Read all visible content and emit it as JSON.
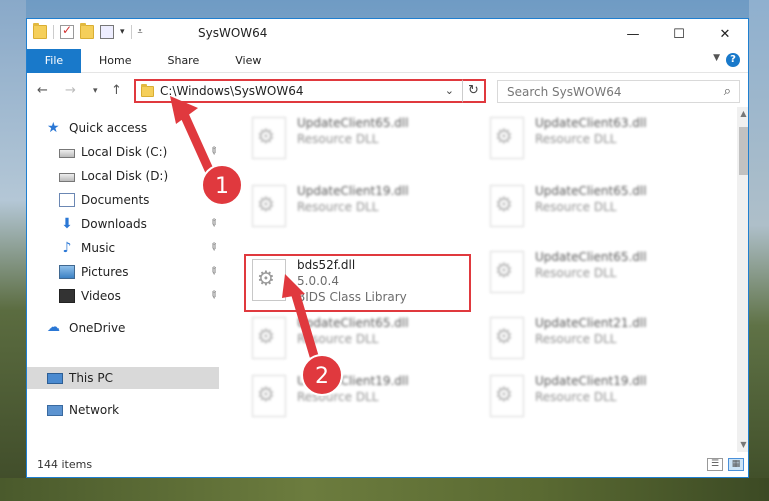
{
  "window": {
    "title": "SysWOW64",
    "controls": {
      "minimize": "—",
      "maximize": "☐",
      "close": "✕"
    }
  },
  "ribbon": {
    "tabs": [
      "File",
      "Home",
      "Share",
      "View"
    ],
    "help": "?"
  },
  "address_bar": {
    "path": "C:\\Windows\\SysWOW64",
    "refresh_icon": "refresh-icon"
  },
  "search": {
    "placeholder": "Search SysWOW64"
  },
  "sidebar": {
    "items": [
      {
        "label": "Quick access",
        "icon": "star-icon",
        "pinned": false
      },
      {
        "label": "Local Disk (C:)",
        "icon": "disk-icon",
        "pinned": true
      },
      {
        "label": "Local Disk (D:)",
        "icon": "disk-icon",
        "pinned": false
      },
      {
        "label": "Documents",
        "icon": "documents-icon",
        "pinned": true
      },
      {
        "label": "Downloads",
        "icon": "downloads-icon",
        "pinned": true
      },
      {
        "label": "Music",
        "icon": "music-icon",
        "pinned": true
      },
      {
        "label": "Pictures",
        "icon": "pictures-icon",
        "pinned": true
      },
      {
        "label": "Videos",
        "icon": "videos-icon",
        "pinned": true
      },
      {
        "label": "OneDrive",
        "icon": "cloud-icon",
        "pinned": false
      },
      {
        "label": "This PC",
        "icon": "computer-icon",
        "pinned": false,
        "selected": true
      },
      {
        "label": "Network",
        "icon": "network-icon",
        "pinned": false
      }
    ]
  },
  "files": {
    "left": [
      {
        "name": "UpdateClient65.dll",
        "line2": "Resource DLL"
      },
      {
        "name": "UpdateClient19.dll",
        "line2": "Resource DLL"
      },
      {
        "name": "bds52f.dll",
        "line2": "5.0.0.4",
        "line3": "BIDS Class Library",
        "highlighted": true
      },
      {
        "name": "UpdateClient65.dll",
        "line2": "Resource DLL"
      },
      {
        "name": "UpdateClient19.dll",
        "line2": "Resource DLL"
      }
    ],
    "right": [
      {
        "name": "UpdateClient63.dll",
        "line2": "Resource DLL"
      },
      {
        "name": "UpdateClient65.dll",
        "line2": "Resource DLL"
      },
      {
        "name": "UpdateClient65.dll",
        "line2": "Resource DLL"
      },
      {
        "name": "UpdateClient21.dll",
        "line2": "Resource DLL"
      },
      {
        "name": "UpdateClient19.dll",
        "line2": "Resource DLL"
      }
    ]
  },
  "status_bar": {
    "item_count": "144 items"
  },
  "annotations": {
    "badge1": "1",
    "badge2": "2"
  },
  "colors": {
    "accent": "#1979ca",
    "annotation": "#e0393e"
  }
}
